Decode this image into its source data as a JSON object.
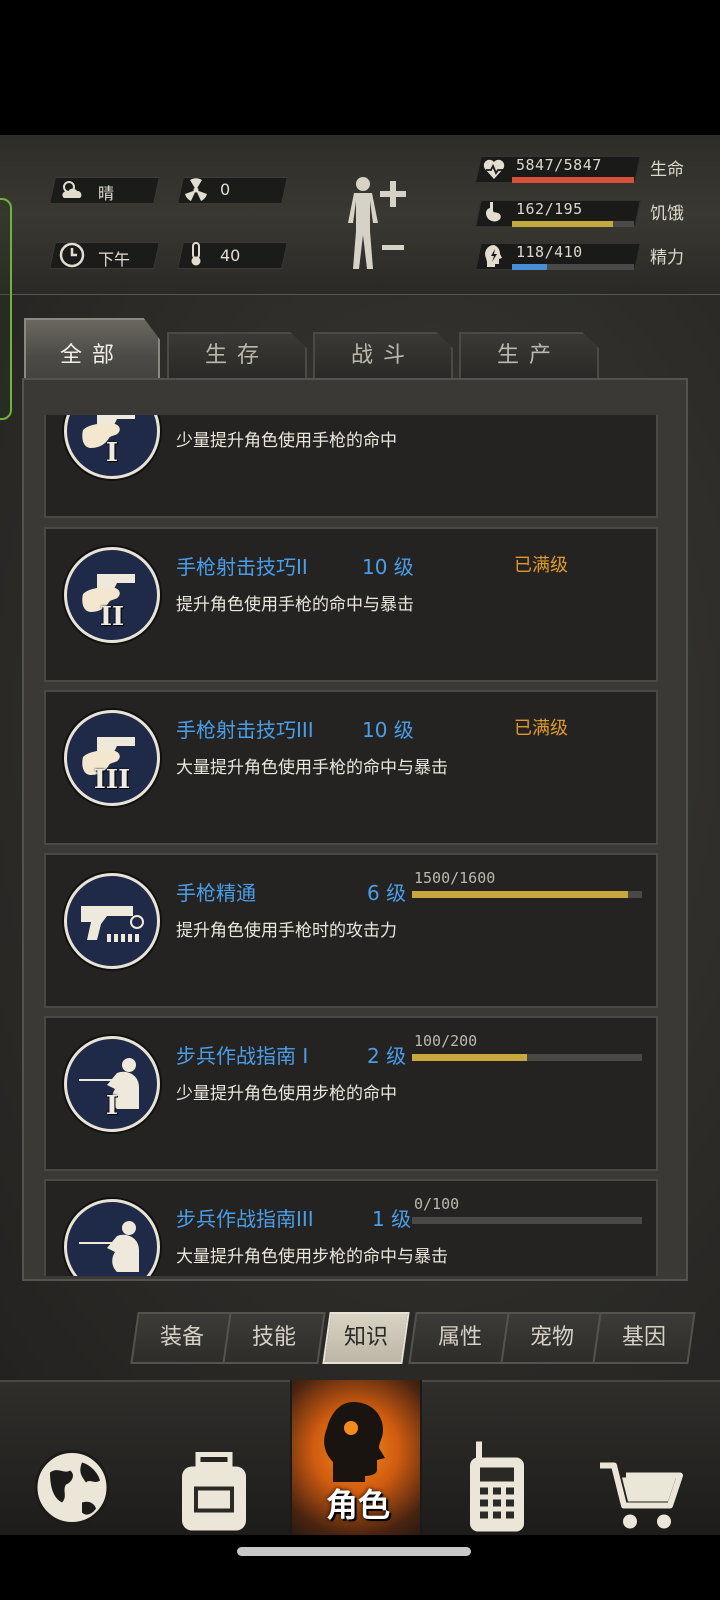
{
  "status": {
    "weather": {
      "icon": "cloud-sun-icon",
      "value": "晴"
    },
    "radiation": {
      "icon": "radiation-icon",
      "value": "0"
    },
    "time": {
      "icon": "clock-icon",
      "value": "下午"
    },
    "temperature": {
      "icon": "thermometer-icon",
      "value": "40"
    }
  },
  "vitals": [
    {
      "icon": "heart-pulse-icon",
      "value": "5847/5847",
      "label": "生命",
      "fraction": 1.0,
      "color": "#d8503a"
    },
    {
      "icon": "stomach-icon",
      "value": "162/195",
      "label": "饥饿",
      "fraction": 0.83,
      "color": "#c7a83e"
    },
    {
      "icon": "brain-bolt-icon",
      "value": "118/410",
      "label": "精力",
      "fraction": 0.29,
      "color": "#4a8fd6"
    }
  ],
  "tabs": [
    "全部",
    "生存",
    "战斗",
    "生产"
  ],
  "active_tab": "全部",
  "skills": [
    {
      "name": "",
      "level": "",
      "desc": "少量提升角色使用手枪的命中",
      "status": "",
      "numeral": "I",
      "type": "pistol"
    },
    {
      "name": "手枪射击技巧II",
      "level": "10 级",
      "desc": "提升角色使用手枪的命中与暴击",
      "status": "已满级",
      "numeral": "II",
      "type": "pistol"
    },
    {
      "name": "手枪射击技巧III",
      "level": "10 级",
      "desc": "大量提升角色使用手枪的命中与暴击",
      "status": "已满级",
      "numeral": "III",
      "type": "pistol"
    },
    {
      "name": "手枪精通",
      "level": "6 级",
      "desc": "提升角色使用手枪时的攻击力",
      "progress_text": "1500/1600",
      "progress": 0.9375,
      "numeral": "",
      "type": "pistol-master"
    },
    {
      "name": "步兵作战指南 I",
      "level": "2 级",
      "desc": "少量提升角色使用步枪的命中",
      "progress_text": "100/200",
      "progress": 0.5,
      "numeral": "I",
      "type": "rifle"
    },
    {
      "name": "步兵作战指南III",
      "level": "1 级",
      "desc": "大量提升角色使用步枪的命中与暴击",
      "progress_text": "0/100",
      "progress": 0.0,
      "numeral": "",
      "type": "rifle"
    }
  ],
  "subnav": [
    "装备",
    "技能",
    "知识",
    "属性",
    "宠物",
    "基因"
  ],
  "subnav_active": "知识",
  "bottom_nav": [
    {
      "icon": "globe-icon",
      "label": ""
    },
    {
      "icon": "backpack-icon",
      "label": ""
    },
    {
      "icon": "character-head-icon",
      "label": "角色"
    },
    {
      "icon": "radio-icon",
      "label": ""
    },
    {
      "icon": "cart-icon",
      "label": ""
    }
  ]
}
